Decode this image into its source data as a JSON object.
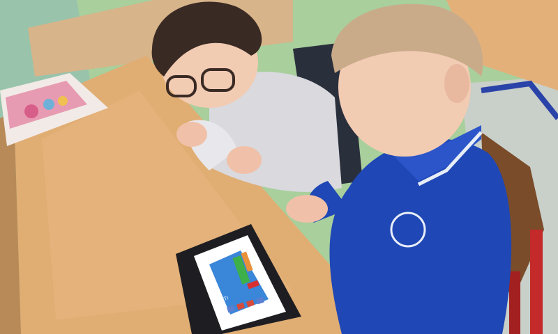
{
  "scene": {
    "colors": {
      "wall": "#a8cf9c",
      "floor": "#c9cfc9",
      "desk": "#e0ad73",
      "desk_edge": "#b88a57",
      "boy_shirt": "#1f47b5",
      "girl_sweater": "#d9d9de",
      "tablet_body": "#1e1e22",
      "tablet_screen": "#3a86d8",
      "chair_red": "#c42a2a"
    },
    "tablet": {
      "badge_text": "TI"
    }
  }
}
